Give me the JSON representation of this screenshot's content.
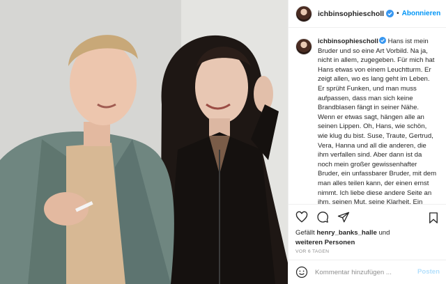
{
  "post": {
    "username": "ichbinsophiescholl",
    "verified_icon": "verified-badge-icon",
    "separator": "•",
    "follow_label": "Abonnieren",
    "caption": "Hans ist mein Bruder und so eine Art Vorbild. Na ja, nicht in allem, zugegeben. Für mich hat Hans etwas von einem Leuchtturm. Er zeigt allen, wo es lang geht im Leben. Er sprüht Funken, und man muss aufpassen, dass man sich keine Brandblasen fängt in seiner Nähe. Wenn er etwas sagt, hängen alle an seinen Lippen. Oh, Hans, wie schön, wie klug du bist. Suse, Traute, Gertrud, Vera, Hanna und all die anderen, die ihm verfallen sind. Aber dann ist da noch mein großer gewissenhafter Bruder, ein unfassbarer Bruder, mit dem man alles teilen kann, der einen ernst nimmt. Ich liebe diese andere Seite an ihm, seinen Mut, seine Klarheit. Ein Leuchtturm, der in die",
    "likes_prefix": "Gefällt",
    "likes_user": "henry_banks_halle",
    "likes_and": "und",
    "likes_others": "weiteren Personen",
    "timestamp": "VOR 6 TAGEN",
    "comment_placeholder": "Kommentar hinzufügen ...",
    "post_label": "Posten"
  },
  "colors": {
    "accent": "#0095f6",
    "post_disabled": "#b2dffc",
    "secondary_text": "#8e8e8e",
    "verified": "#3897f0"
  },
  "icons": [
    "heart-icon",
    "comment-icon",
    "share-icon",
    "bookmark-icon",
    "emoji-icon",
    "verified-badge-icon"
  ]
}
